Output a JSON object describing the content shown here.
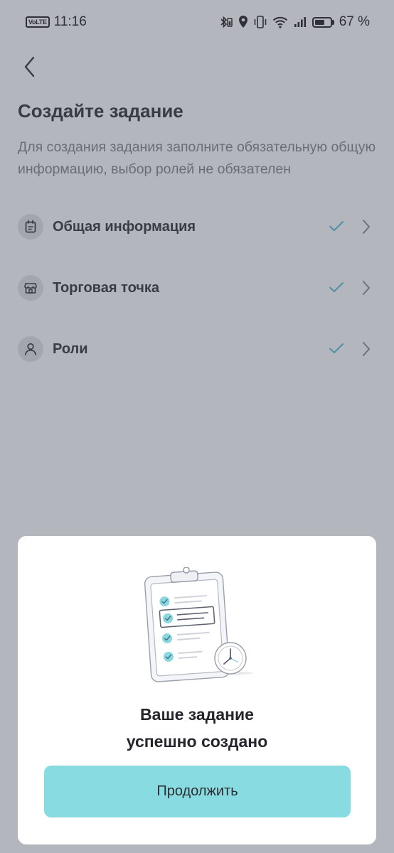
{
  "status_bar": {
    "network_badge": "VoLTE",
    "time": "11:16",
    "battery_percent": "67 %",
    "battery_level": 0.67,
    "icons": [
      "bluetooth-battery-icon",
      "location-icon",
      "vibrate-icon",
      "wifi-icon",
      "signal-icon",
      "battery-icon"
    ]
  },
  "header": {
    "back_icon": "chevron-left-icon",
    "title": "Создайте задание",
    "subtitle": "Для создания задания заполните обязательную общую информацию, выбор ролей не обязателен"
  },
  "menu": {
    "items": [
      {
        "label": "Общая информация",
        "icon": "calendar-list-icon",
        "completed": true
      },
      {
        "label": "Торговая точка",
        "icon": "store-icon",
        "completed": true
      },
      {
        "label": "Роли",
        "icon": "user-icon",
        "completed": true
      }
    ]
  },
  "sheet": {
    "illustration": "clipboard-checklist-clock-icon",
    "title_line1": "Ваше задание",
    "title_line2": "успешно создано",
    "button_label": "Продолжить"
  },
  "colors": {
    "overlay_background": "#b4b6bd",
    "accent": "#88dbe0",
    "check": "#4f8fa6",
    "sheet": "#ffffff"
  }
}
